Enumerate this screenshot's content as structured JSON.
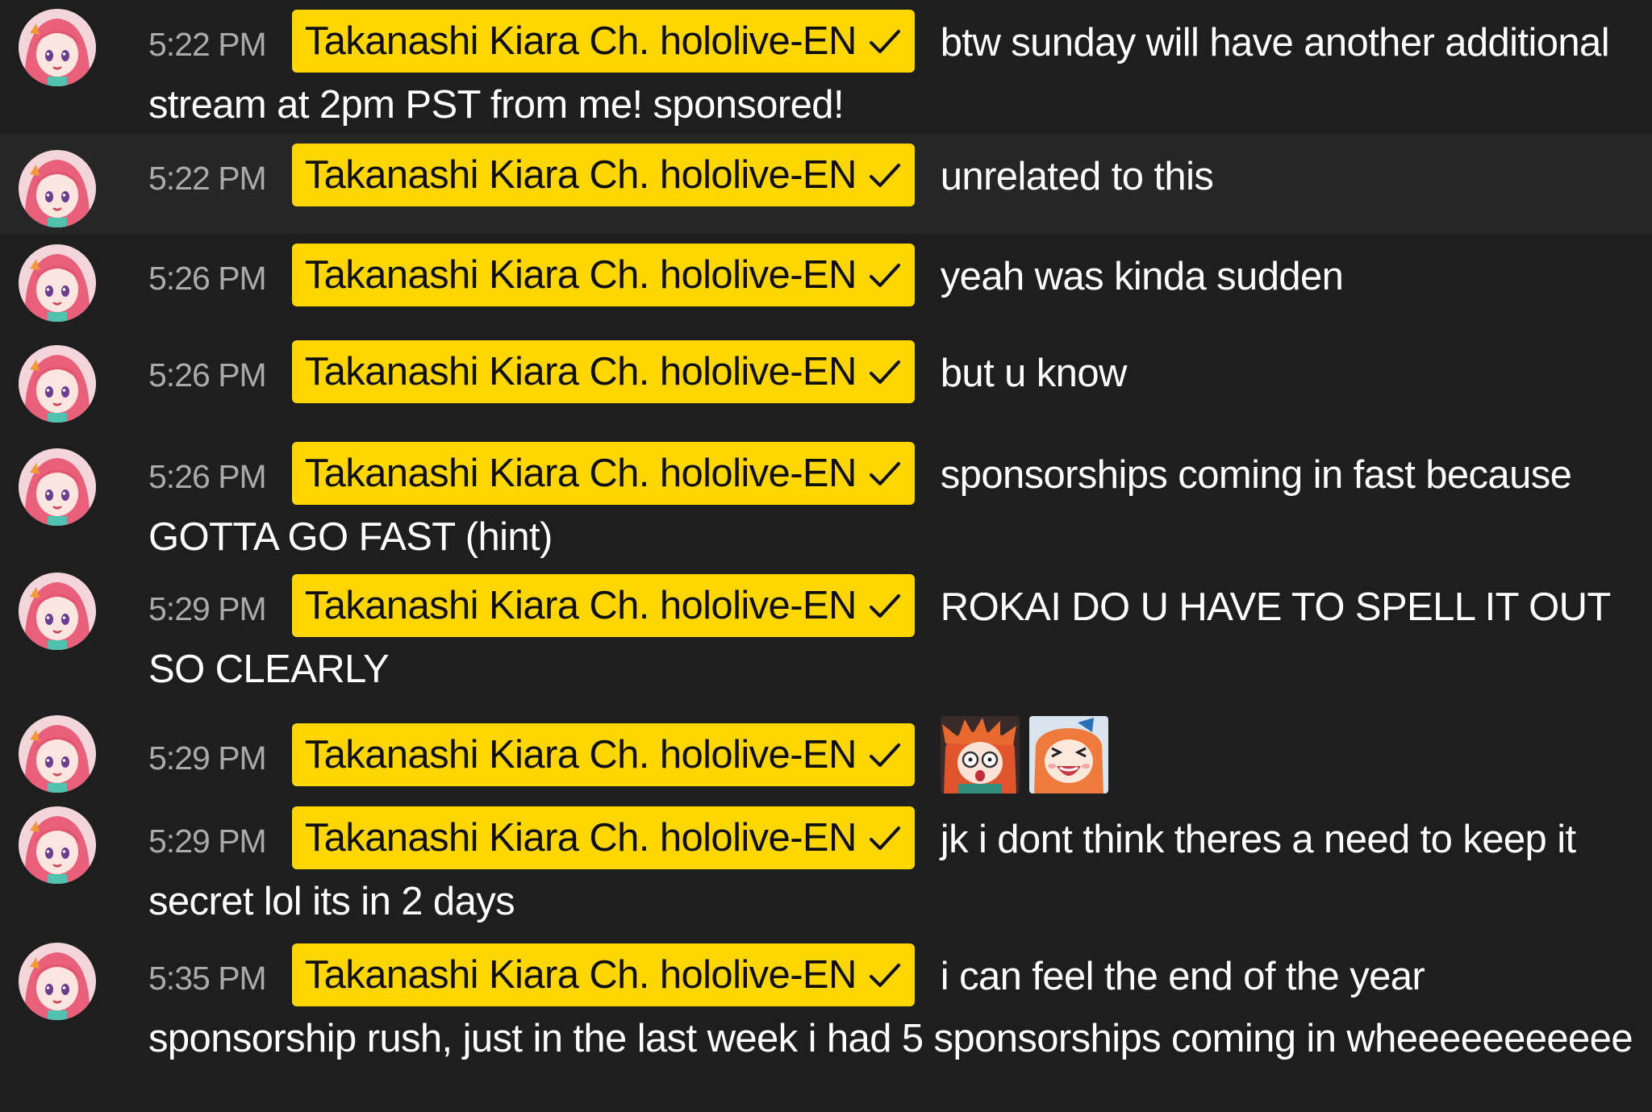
{
  "chat": {
    "author": "Takanashi Kiara Ch. hololive-EN",
    "author_verified_icon": "checkmark-icon",
    "badge_color": "#ffd600",
    "messages": [
      {
        "time": "5:22 PM",
        "text": "btw sunday will have another additional stream at 2pm PST from me! sponsored!"
      },
      {
        "time": "5:22 PM",
        "text": "unrelated to this"
      },
      {
        "time": "5:26 PM",
        "text": "yeah was kinda sudden"
      },
      {
        "time": "5:26 PM",
        "text": "but u know"
      },
      {
        "time": "5:26 PM",
        "text": "sponsorships coming in fast because GOTTA GO FAST (hint)"
      },
      {
        "time": "5:29 PM",
        "text": "ROKAI DO U HAVE TO SPELL IT OUT SO CLEARLY"
      },
      {
        "time": "5:29 PM",
        "text": "",
        "emotes": [
          "surprised-emote",
          "laughing-emote"
        ]
      },
      {
        "time": "5:29 PM",
        "text": "jk i dont think theres a need to keep it secret lol its in 2 days"
      },
      {
        "time": "5:35 PM",
        "text": "i can feel the end of the year sponsorship rush, just in the last week i had 5 sponsorships coming in wheeeeeeeeeee"
      }
    ]
  }
}
